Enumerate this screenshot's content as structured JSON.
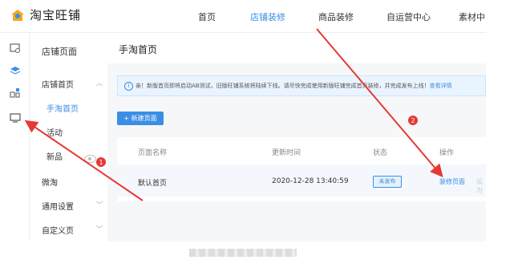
{
  "header": {
    "logo_text": "淘宝旺铺",
    "nav": [
      "首页",
      "店铺装修",
      "商品装修",
      "自运营中心",
      "素材中"
    ]
  },
  "sidebar": {
    "section_title": "店铺页面",
    "items": [
      {
        "label": "店铺首页"
      },
      {
        "label": "手淘首页"
      },
      {
        "label": "活动"
      },
      {
        "label": "新品"
      },
      {
        "label": "微淘"
      },
      {
        "label": "通用设置"
      },
      {
        "label": "自定义页"
      }
    ]
  },
  "main": {
    "title": "手淘首页",
    "notice": "亲！新版首页即将启动AB测试，旧版旺铺系统将陆续下线。请尽快完成使用新版旺铺完成首页装修，并完成发布上线！",
    "notice_link": "查看详情",
    "new_button": "+ 新建页面",
    "table": {
      "headers": [
        "页面名称",
        "更新时间",
        "状态",
        "操作"
      ],
      "rows": [
        {
          "name": "默认首页",
          "updated": "2020-12-28 13:40:59",
          "status": "未发布",
          "action": "装修页面",
          "action2": "设为"
        }
      ]
    }
  },
  "annotations": {
    "marker1": "1",
    "marker2": "2",
    "color": "#e53935"
  },
  "colors": {
    "accent": "#3a8ee6",
    "annotation": "#e53935"
  }
}
